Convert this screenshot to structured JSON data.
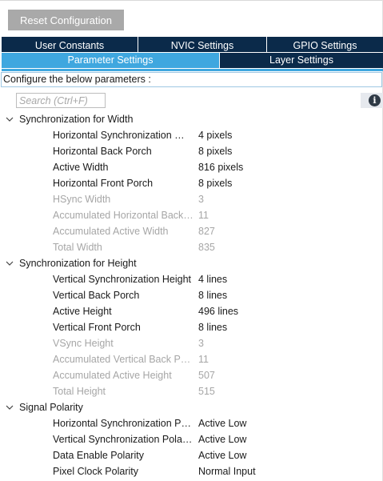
{
  "toolbar": {
    "reset_label": "Reset Configuration"
  },
  "tabs": {
    "row1": [
      {
        "label": "User Constants",
        "active": false
      },
      {
        "label": "NVIC Settings",
        "active": false
      },
      {
        "label": "GPIO Settings",
        "active": false
      }
    ],
    "row2": [
      {
        "label": "Parameter Settings",
        "active": true
      },
      {
        "label": "Layer Settings",
        "active": false
      }
    ]
  },
  "configure_text": "Configure the below parameters :",
  "search": {
    "placeholder": "Search (Ctrl+F)",
    "value": ""
  },
  "info_icon": "info-icon",
  "colors": {
    "tab_dark": "#0b2a4a",
    "tab_active": "#3fa7df",
    "disabled_text": "#a6a6a6",
    "reset_button": "#a9a9a9"
  },
  "groups": [
    {
      "label": "Synchronization for Width",
      "expanded": true,
      "params": [
        {
          "name": "Horizontal Synchronization Width",
          "value": "4 pixels",
          "enabled": true
        },
        {
          "name": "Horizontal Back Porch",
          "value": "8 pixels",
          "enabled": true
        },
        {
          "name": "Active Width",
          "value": "816 pixels",
          "enabled": true
        },
        {
          "name": "Horizontal Front Porch",
          "value": "8 pixels",
          "enabled": true
        },
        {
          "name": "HSync Width",
          "value": "3",
          "enabled": false
        },
        {
          "name": "Accumulated Horizontal Back Porch",
          "value": "11",
          "enabled": false
        },
        {
          "name": "Accumulated Active Width",
          "value": "827",
          "enabled": false
        },
        {
          "name": "Total Width",
          "value": "835",
          "enabled": false
        }
      ]
    },
    {
      "label": "Synchronization for Height",
      "expanded": true,
      "params": [
        {
          "name": "Vertical Synchronization Height",
          "value": "4 lines",
          "enabled": true
        },
        {
          "name": "Vertical Back Porch",
          "value": "8 lines",
          "enabled": true
        },
        {
          "name": "Active Height",
          "value": "496 lines",
          "enabled": true
        },
        {
          "name": "Vertical Front Porch",
          "value": "8 lines",
          "enabled": true
        },
        {
          "name": "VSync Height",
          "value": "3",
          "enabled": false
        },
        {
          "name": "Accumulated Vertical Back Porch",
          "value": "11",
          "enabled": false
        },
        {
          "name": "Accumulated Active Height",
          "value": "507",
          "enabled": false
        },
        {
          "name": "Total Height",
          "value": "515",
          "enabled": false
        }
      ]
    },
    {
      "label": "Signal Polarity",
      "expanded": true,
      "params": [
        {
          "name": "Horizontal Synchronization Polarity",
          "value": "Active Low",
          "enabled": true
        },
        {
          "name": "Vertical Synchronization Polarity",
          "value": "Active Low",
          "enabled": true
        },
        {
          "name": "Data Enable Polarity",
          "value": "Active Low",
          "enabled": true
        },
        {
          "name": "Pixel Clock Polarity",
          "value": "Normal Input",
          "enabled": true
        }
      ]
    }
  ]
}
